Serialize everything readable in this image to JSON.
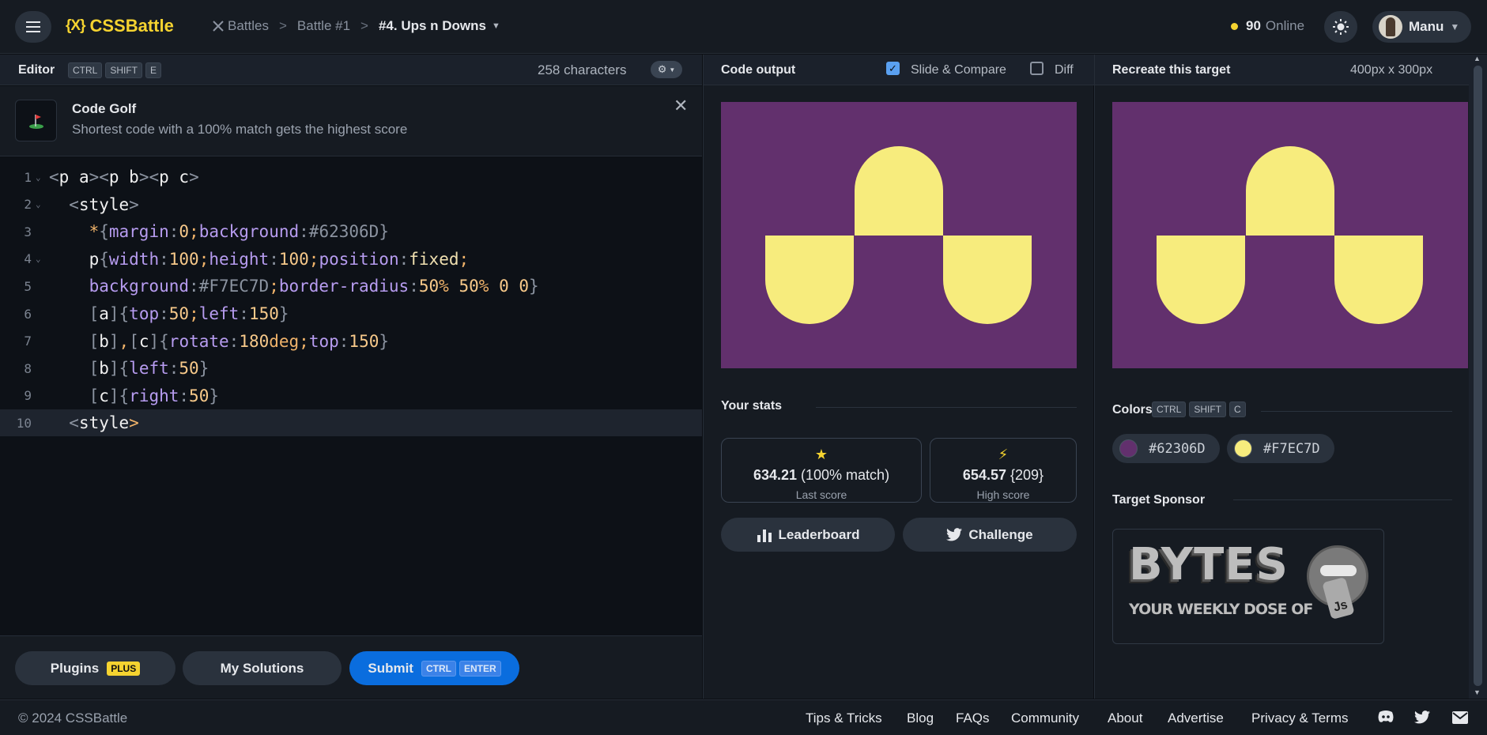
{
  "header": {
    "menu_icon": "hamburger-icon",
    "logo_text": "CSSBattle",
    "logo_mark": "{X}",
    "crumbs": [
      "Battles",
      "Battle #1",
      "#4. Ups n Downs"
    ],
    "online_count": "90",
    "online_label": "Online",
    "user_name": "Manu"
  },
  "editor": {
    "title": "Editor",
    "keys": [
      "CTRL",
      "SHIFT",
      "E"
    ],
    "char_count": "258 characters",
    "golf_title": "Code Golf",
    "golf_sub": "Shortest code with a 100% match gets the highest score",
    "lines": [
      {
        "n": "1",
        "segs": [
          [
            "c-p",
            "<"
          ],
          [
            "c-t",
            "p a"
          ],
          [
            "c-p",
            "><"
          ],
          [
            "c-t",
            "p b"
          ],
          [
            "c-p",
            "><"
          ],
          [
            "c-t",
            "p c"
          ],
          [
            "c-p",
            ">"
          ]
        ]
      },
      {
        "n": "2",
        "segs": [
          [
            "c-p",
            "  <"
          ],
          [
            "c-t",
            "style"
          ],
          [
            "c-p",
            ">"
          ]
        ]
      },
      {
        "n": "3",
        "segs": [
          [
            "c-sel",
            "    *"
          ],
          [
            "c-p",
            "{"
          ],
          [
            "c-prop",
            "margin"
          ],
          [
            "c-p",
            ":"
          ],
          [
            "c-num",
            "0"
          ],
          [
            "c-sel",
            ";"
          ],
          [
            "c-prop",
            "background"
          ],
          [
            "c-p",
            ":"
          ],
          [
            "c-p",
            "#62306D"
          ],
          [
            "c-p",
            "}"
          ]
        ]
      },
      {
        "n": "4",
        "segs": [
          [
            "c-t",
            "    p"
          ],
          [
            "c-p",
            "{"
          ],
          [
            "c-prop",
            "width"
          ],
          [
            "c-p",
            ":"
          ],
          [
            "c-num",
            "100"
          ],
          [
            "c-sel",
            ";"
          ],
          [
            "c-prop",
            "height"
          ],
          [
            "c-p",
            ":"
          ],
          [
            "c-num",
            "100"
          ],
          [
            "c-sel",
            ";"
          ],
          [
            "c-prop",
            "position"
          ],
          [
            "c-p",
            ":"
          ],
          [
            "c-val",
            "fixed"
          ],
          [
            "c-sel",
            ";"
          ]
        ]
      },
      {
        "n": "5",
        "segs": [
          [
            "c-prop",
            "    background"
          ],
          [
            "c-p",
            ":"
          ],
          [
            "c-p",
            "#F7EC7D"
          ],
          [
            "c-sel",
            ";"
          ],
          [
            "c-prop",
            "border-radius"
          ],
          [
            "c-p",
            ":"
          ],
          [
            "c-num",
            "50"
          ],
          [
            "c-sel",
            "%"
          ],
          [
            "c-num",
            " 50"
          ],
          [
            "c-sel",
            "%"
          ],
          [
            "c-num",
            " 0 0"
          ],
          [
            "c-p",
            "}"
          ]
        ]
      },
      {
        "n": "6",
        "segs": [
          [
            "c-p",
            "    ["
          ],
          [
            "c-t",
            "a"
          ],
          [
            "c-p",
            "]{"
          ],
          [
            "c-prop",
            "top"
          ],
          [
            "c-p",
            ":"
          ],
          [
            "c-num",
            "50"
          ],
          [
            "c-sel",
            ";"
          ],
          [
            "c-prop",
            "left"
          ],
          [
            "c-p",
            ":"
          ],
          [
            "c-num",
            "150"
          ],
          [
            "c-p",
            "}"
          ]
        ]
      },
      {
        "n": "7",
        "segs": [
          [
            "c-p",
            "    ["
          ],
          [
            "c-t",
            "b"
          ],
          [
            "c-p",
            "]"
          ],
          [
            "c-sel",
            ","
          ],
          [
            "c-p",
            "["
          ],
          [
            "c-t",
            "c"
          ],
          [
            "c-p",
            "]{"
          ],
          [
            "c-prop",
            "rotate"
          ],
          [
            "c-p",
            ":"
          ],
          [
            "c-num",
            "180"
          ],
          [
            "c-sel",
            "deg;"
          ],
          [
            "c-prop",
            "top"
          ],
          [
            "c-p",
            ":"
          ],
          [
            "c-num",
            "150"
          ],
          [
            "c-p",
            "}"
          ]
        ]
      },
      {
        "n": "8",
        "segs": [
          [
            "c-p",
            "    ["
          ],
          [
            "c-t",
            "b"
          ],
          [
            "c-p",
            "]{"
          ],
          [
            "c-prop",
            "left"
          ],
          [
            "c-p",
            ":"
          ],
          [
            "c-num",
            "50"
          ],
          [
            "c-p",
            "}"
          ]
        ]
      },
      {
        "n": "9",
        "segs": [
          [
            "c-p",
            "    ["
          ],
          [
            "c-t",
            "c"
          ],
          [
            "c-p",
            "]{"
          ],
          [
            "c-prop",
            "right"
          ],
          [
            "c-p",
            ":"
          ],
          [
            "c-num",
            "50"
          ],
          [
            "c-p",
            "}"
          ]
        ]
      },
      {
        "n": "10",
        "segs": [
          [
            "c-p",
            "  <"
          ],
          [
            "c-t",
            "style"
          ],
          [
            "c-sel",
            ">"
          ]
        ]
      }
    ],
    "plugins_label": "Plugins",
    "plugins_badge": "PLUS",
    "solutions_label": "My Solutions",
    "submit_label": "Submit",
    "submit_keys": [
      "CTRL",
      "ENTER"
    ]
  },
  "output": {
    "title": "Code output",
    "slide_label": "Slide & Compare",
    "diff_label": "Diff",
    "stats_title": "Your stats",
    "last_score": "634.21",
    "last_match": "(100% match)",
    "last_label": "Last score",
    "high_score": "654.57",
    "high_chars": "{209}",
    "high_label": "High score",
    "leaderboard_label": "Leaderboard",
    "challenge_label": "Challenge"
  },
  "target": {
    "title": "Recreate this target",
    "size": "400px x 300px",
    "colors_title": "Colors",
    "colors_keys": [
      "CTRL",
      "SHIFT",
      "C"
    ],
    "colors": [
      "#62306D",
      "#F7EC7D"
    ],
    "sponsor_title": "Target Sponsor",
    "sponsor_logo": "BYTES",
    "sponsor_tag": "YOUR WEEKLY DOSE OF",
    "sponsor_js": "Js"
  },
  "footer": {
    "copyright": "© 2024 CSSBattle",
    "links": [
      "Tips & Tricks",
      "Blog",
      "FAQs",
      "Community",
      "About",
      "Advertise",
      "Privacy & Terms"
    ]
  }
}
